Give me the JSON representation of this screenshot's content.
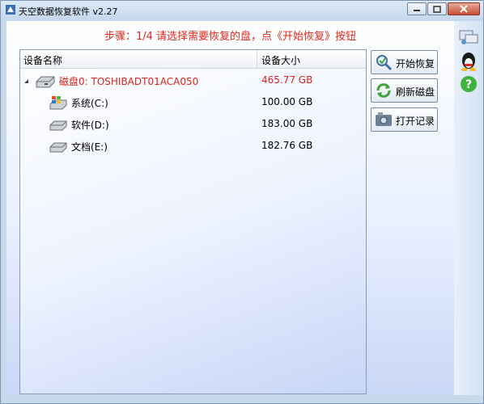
{
  "window": {
    "title": "天空数据恢复软件 v2.27"
  },
  "step_text": "步骤：1/4 请选择需要恢复的盘，点《开始恢复》按钮",
  "list": {
    "columns": [
      "设备名称",
      "设备大小"
    ],
    "rows": [
      {
        "name": "磁盘0: TOSHIBADT01ACA050",
        "size": "465.77 GB"
      },
      {
        "name": "系统(C:)",
        "size": "100.00 GB"
      },
      {
        "name": "软件(D:)",
        "size": "183.00 GB"
      },
      {
        "name": "文档(E:)",
        "size": "182.76 GB"
      }
    ]
  },
  "buttons": {
    "start": "开始恢复",
    "refresh": "刷新磁盘",
    "record": "打开记录"
  },
  "colors": {
    "accent_red": "#e0231b"
  }
}
